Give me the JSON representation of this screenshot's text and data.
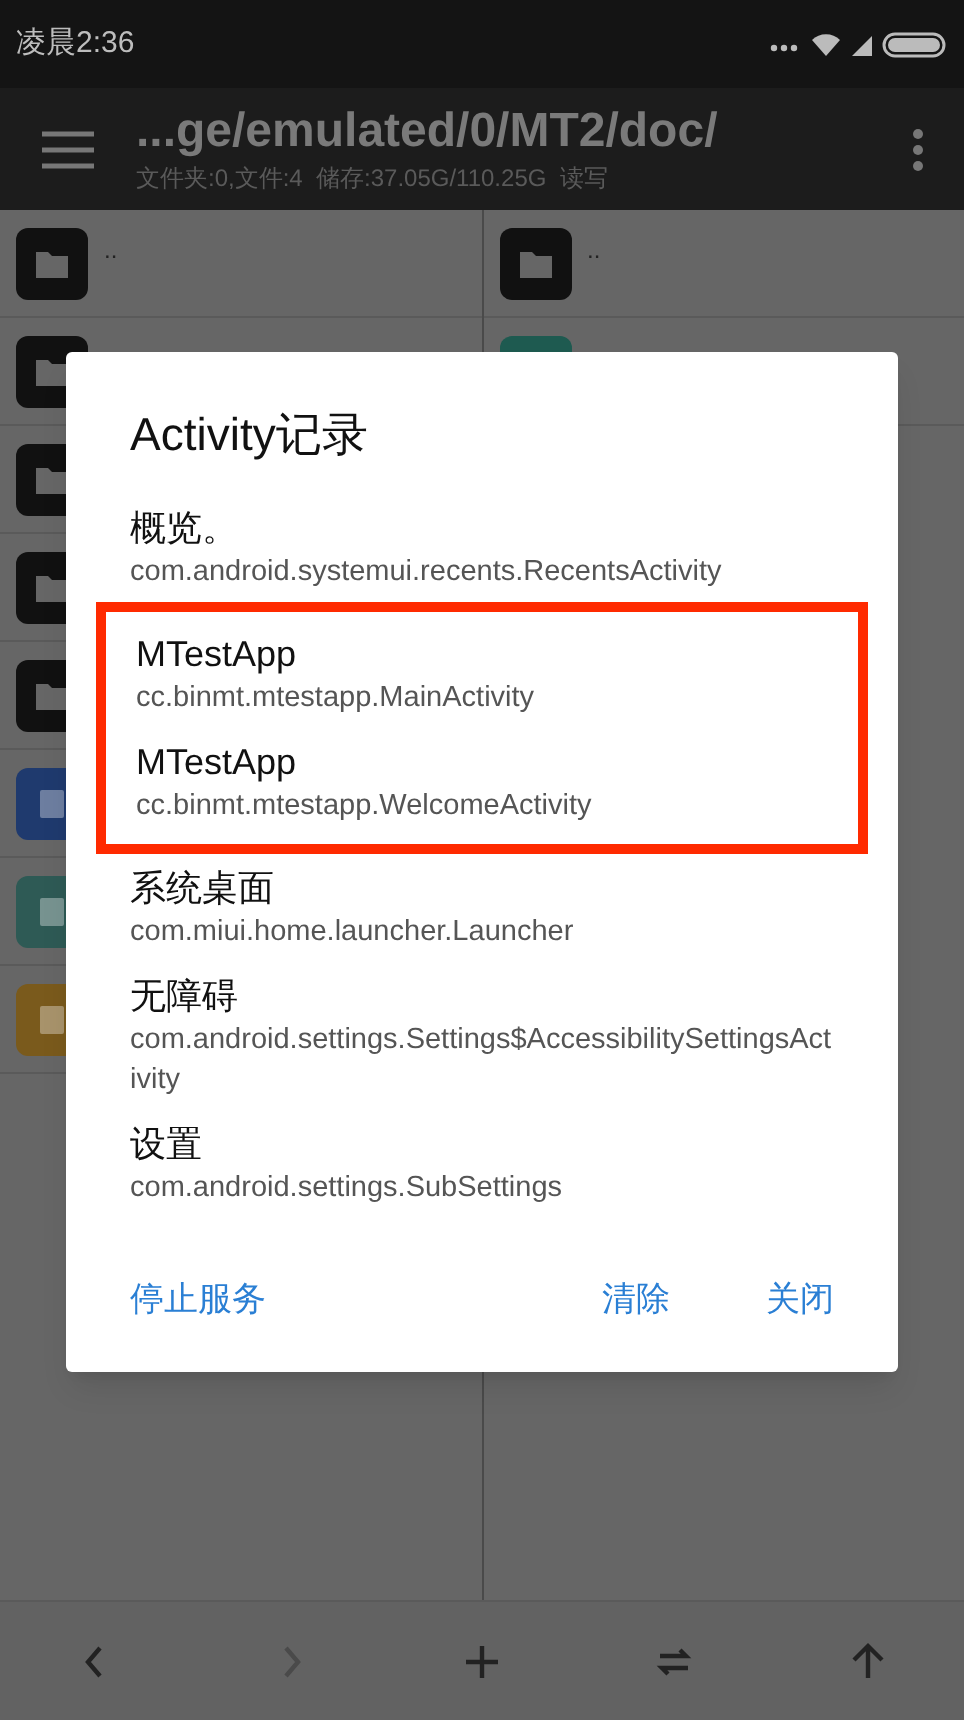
{
  "status_bar": {
    "time": "凌晨2:36"
  },
  "toolbar": {
    "path": "...ge/emulated/0/MT2/doc/",
    "info": "文件夹:0,文件:4  储存:37.05G/110.25G  读写"
  },
  "left_pane": {
    "items": [
      {
        "kind": "folder",
        "name": ".."
      },
      {
        "kind": "folder"
      },
      {
        "kind": "folder"
      },
      {
        "kind": "folder"
      },
      {
        "kind": "folder"
      },
      {
        "kind": "code"
      },
      {
        "kind": "binary"
      },
      {
        "kind": "layers"
      }
    ]
  },
  "right_pane": {
    "items": [
      {
        "kind": "folder",
        "name": ".."
      },
      {
        "kind": "apk"
      }
    ]
  },
  "dialog": {
    "title": "Activity记录",
    "entries": [
      {
        "label": "概览。",
        "activity": "com.android.systemui.recents.RecentsActivity",
        "highlighted": false
      },
      {
        "label": "MTestApp",
        "activity": "cc.binmt.mtestapp.MainActivity",
        "highlighted": true
      },
      {
        "label": "MTestApp",
        "activity": "cc.binmt.mtestapp.WelcomeActivity",
        "highlighted": true
      },
      {
        "label": "系统桌面",
        "activity": "com.miui.home.launcher.Launcher",
        "highlighted": false
      },
      {
        "label": "无障碍",
        "activity": "com.android.settings.Settings$AccessibilitySettingsActivity",
        "highlighted": false
      },
      {
        "label": "设置",
        "activity": "com.android.settings.SubSettings",
        "highlighted": false
      }
    ],
    "buttons": [
      "停止服务",
      "清除",
      "关闭"
    ]
  },
  "bottom_bar": {
    "items": [
      {
        "kind": "back",
        "disabled": false
      },
      {
        "kind": "forward",
        "disabled": true
      },
      {
        "kind": "add",
        "disabled": false
      },
      {
        "kind": "swap",
        "disabled": false
      },
      {
        "kind": "up",
        "disabled": false
      }
    ]
  }
}
